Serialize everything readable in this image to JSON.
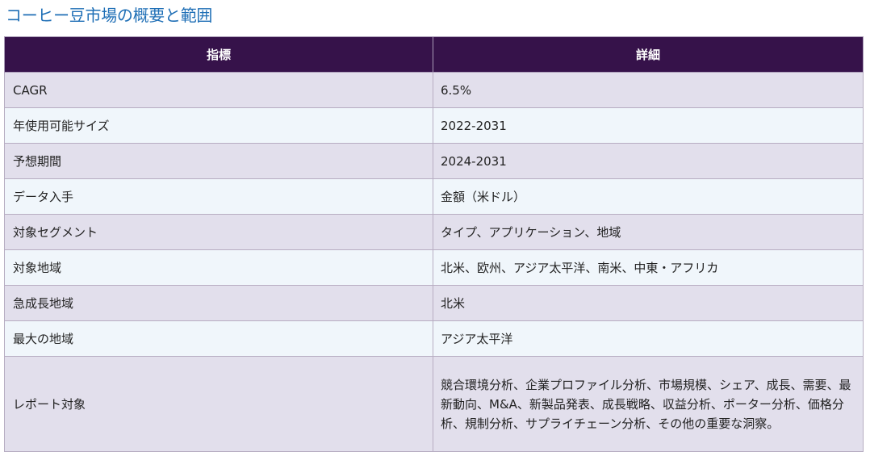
{
  "page": {
    "title": "コーヒー豆市場の概要と範囲"
  },
  "table": {
    "headers": [
      "指標",
      "詳細"
    ],
    "rows": [
      {
        "label": "CAGR",
        "value": "6.5%"
      },
      {
        "label": "年使用可能サイズ",
        "value": "2022-2031"
      },
      {
        "label": "予想期間",
        "value": "2024-2031"
      },
      {
        "label": "データ入手",
        "value": "金額（米ドル）"
      },
      {
        "label": "対象セグメント",
        "value": "タイプ、アプリケーション、地域"
      },
      {
        "label": "対象地域",
        "value": "北米、欧州、アジア太平洋、南米、中東・アフリカ"
      },
      {
        "label": "急成長地域",
        "value": "北米"
      },
      {
        "label": "最大の地域",
        "value": "アジア太平洋"
      },
      {
        "label": "レポート対象",
        "value": "競合環境分析、企業プロファイル分析、市場規模、シェア、成長、需要、最新動向、M&A、新製品発表、成長戦略、収益分析、ポーター分析、価格分析、規制分析、サプライチェーン分析、その他の重要な洞察。"
      }
    ]
  }
}
